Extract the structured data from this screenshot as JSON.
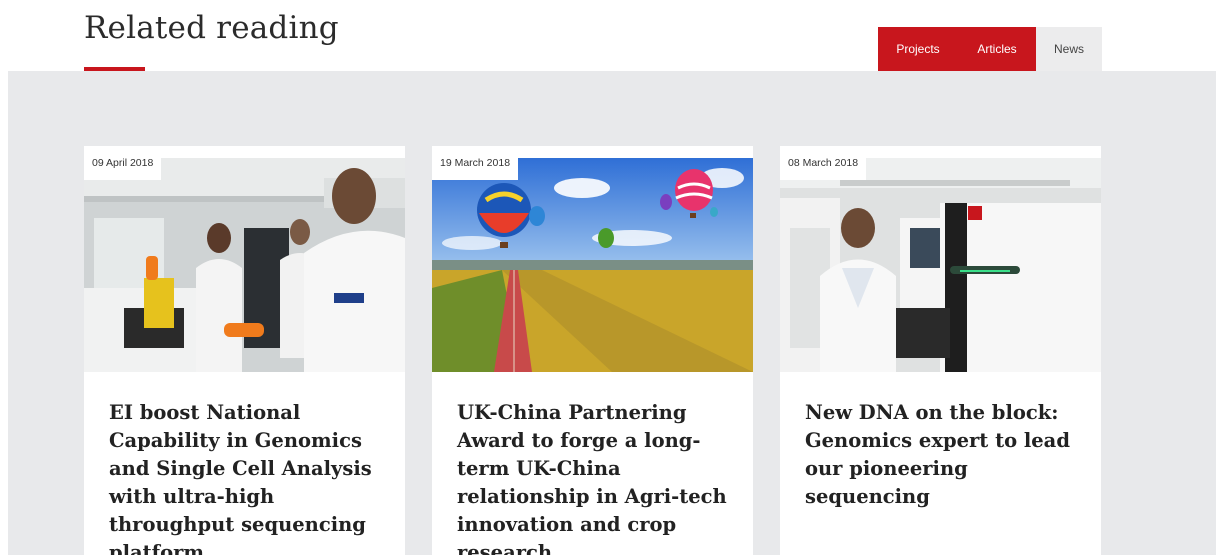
{
  "header": {
    "title": "Related reading"
  },
  "tabs": [
    {
      "label": "Projects",
      "active": true
    },
    {
      "label": "Articles",
      "active": true
    },
    {
      "label": "News",
      "active": false
    }
  ],
  "colors": {
    "accent": "#c8161d",
    "background_grey": "#e8e9eb",
    "tab_inactive_bg": "#ececed"
  },
  "cards": [
    {
      "date": "09 April 2018",
      "title": "EI boost National Capability in Genomics and Single Cell Analysis with ultra-high throughput sequencing platform",
      "image": "lab-scientists-photo"
    },
    {
      "date": "19 March 2018",
      "title": "UK-China Partnering Award to forge a long-term UK-China relationship in Agri-tech innovation and crop research",
      "image": "hot-air-balloons-over-fields-photo"
    },
    {
      "date": "08 March 2018",
      "title": "New DNA on the block: Genomics expert to lead our pioneering sequencing",
      "image": "sequencing-lab-photo"
    }
  ]
}
